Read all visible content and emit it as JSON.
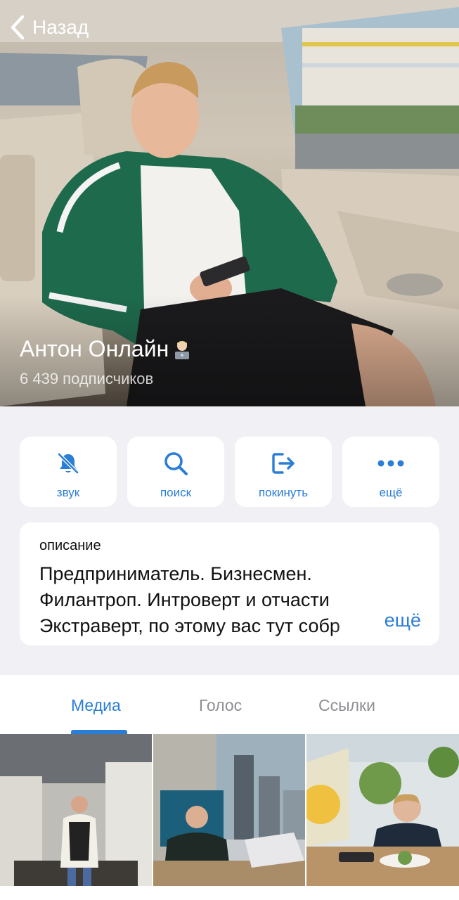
{
  "header": {
    "back_label": "Назад"
  },
  "channel": {
    "name": "Антон Онлайн",
    "name_emoji_icon": "technologist-emoji-icon",
    "subscribers": "6 439 подписчиков"
  },
  "actions": [
    {
      "label": "звук",
      "icon": "bell-muted-icon"
    },
    {
      "label": "поиск",
      "icon": "search-icon"
    },
    {
      "label": "покинуть",
      "icon": "leave-icon"
    },
    {
      "label": "ещё",
      "icon": "more-dots-icon"
    }
  ],
  "description": {
    "label": "описание",
    "lines": [
      "Предприниматель. Бизнесмен.",
      "Филантроп. Интроверт и отчасти",
      "Экстраверт, по этому вас тут собр"
    ],
    "more_label": "ещё"
  },
  "tabs": [
    {
      "label": "Медиа",
      "active": true
    },
    {
      "label": "Голос",
      "active": false
    },
    {
      "label": "Ссылки",
      "active": false
    }
  ],
  "media": [
    {
      "kind": "photo",
      "subject": "man-in-room-photo"
    },
    {
      "kind": "photo",
      "subject": "man-in-office-photo"
    },
    {
      "kind": "photo",
      "subject": "man-at-cafe-photo"
    }
  ],
  "colors": {
    "accent": "#2b7dd6",
    "background": "#f1f1f5",
    "card": "#ffffff",
    "muted_text": "#8e8e93"
  }
}
